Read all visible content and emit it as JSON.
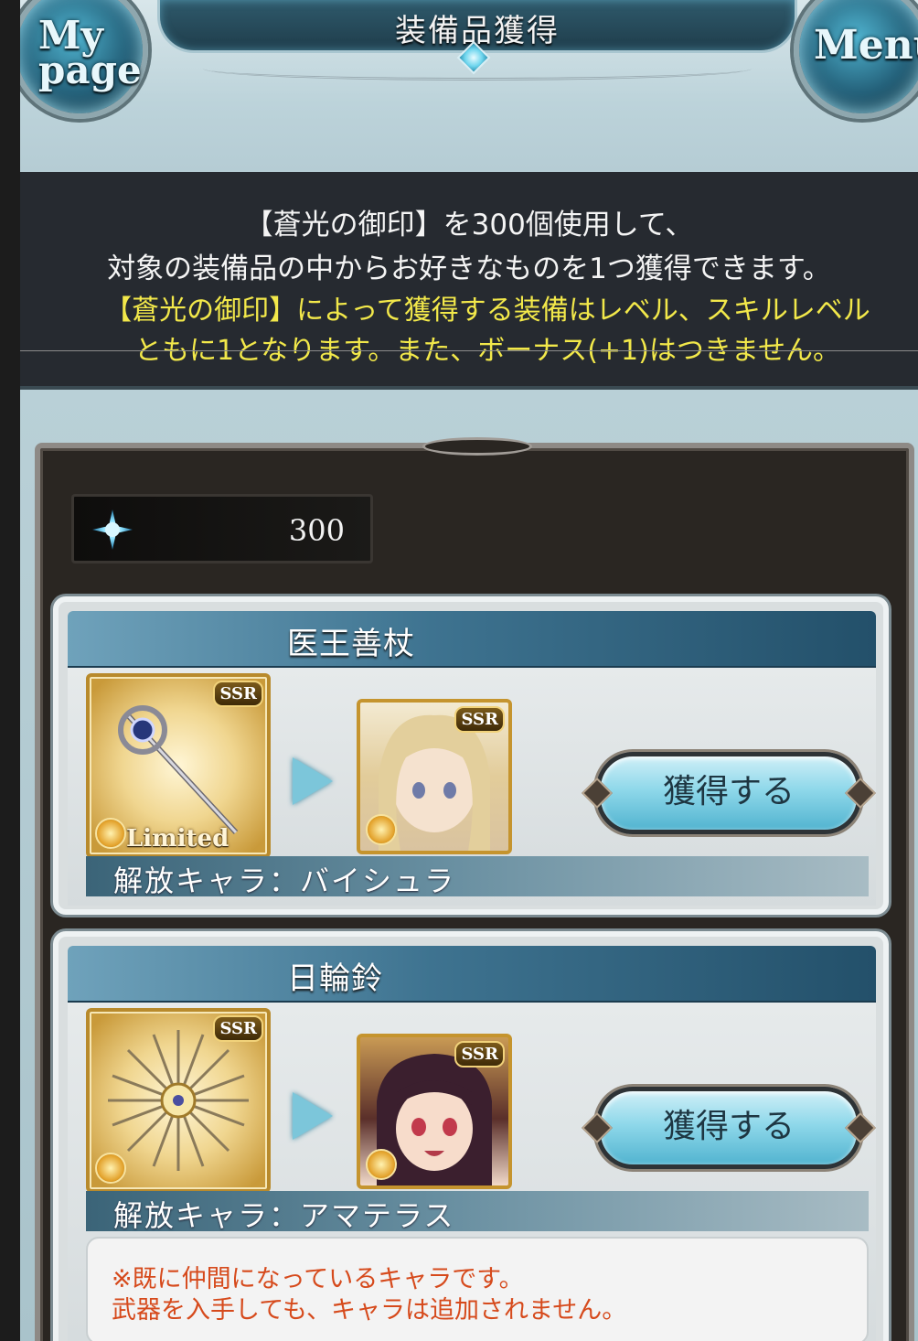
{
  "header": {
    "title": "装備品獲得",
    "my_page_label": "My page",
    "menu_label": "Menu"
  },
  "notice": {
    "line1": "【蒼光の御印】を300個使用して、",
    "line2": "対象の装備品の中からお好きなものを1つ獲得できます。",
    "line3": "【蒼光の御印】によって獲得する装備はレベル、スキルレベル",
    "line4": "ともに1となります。また、ボーナス(+1)はつきません。"
  },
  "currency": {
    "icon": "blue-star-crystal-icon",
    "value": "300"
  },
  "items": [
    {
      "name": "医王善杖",
      "rarity": "SSR",
      "limited_label": "Limited",
      "obtain_label": "獲得する",
      "release_text": "解放キャラ：バイシュラ"
    },
    {
      "name": "日輪鈴",
      "rarity": "SSR",
      "obtain_label": "獲得する",
      "release_text": "解放キャラ：アマテラス",
      "warning_line1": "※既に仲間になっているキャラです。",
      "warning_line2": "武器を入手しても、キャラは追加されません。"
    }
  ],
  "colors": {
    "notice_highlight": "#f2e84a",
    "warning": "#d64a1c",
    "button": "#8fd8ea"
  }
}
